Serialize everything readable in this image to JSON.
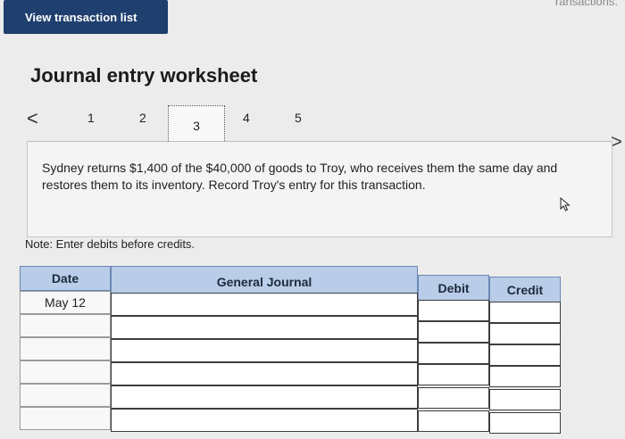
{
  "header": {
    "corner_text": "ransactions.",
    "view_button_label": "View transaction list"
  },
  "worksheet": {
    "title": "Journal entry worksheet",
    "pager": {
      "prev": "<",
      "pages": [
        "1",
        "2",
        "3",
        "4",
        "5"
      ],
      "active": "3",
      "next": ">"
    },
    "instruction": "Sydney returns $1,400 of the $40,000 of goods to Troy, who receives them the same day and restores them to its inventory. Record Troy's entry for this transaction.",
    "note": "Note: Enter debits before credits."
  },
  "journal": {
    "columns": {
      "date": "Date",
      "general_journal": "General Journal",
      "debit": "Debit",
      "credit": "Credit"
    },
    "rows": [
      {
        "date": "May 12",
        "account": "",
        "debit": "",
        "credit": ""
      },
      {
        "date": "",
        "account": "",
        "debit": "",
        "credit": ""
      },
      {
        "date": "",
        "account": "",
        "debit": "",
        "credit": ""
      },
      {
        "date": "",
        "account": "",
        "debit": "",
        "credit": ""
      },
      {
        "date": "",
        "account": "",
        "debit": "",
        "credit": ""
      },
      {
        "date": "",
        "account": "",
        "debit": "",
        "credit": ""
      }
    ]
  },
  "colors": {
    "button_bg": "#1f3f6e",
    "header_bg": "#b9cde8",
    "page_bg": "#ececec"
  }
}
